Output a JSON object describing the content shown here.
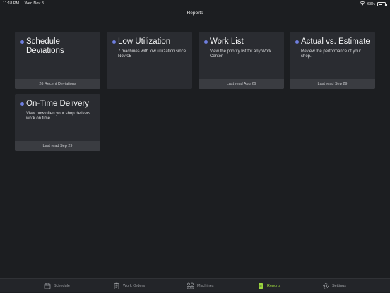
{
  "status": {
    "time": "11:18 PM",
    "date": "Wed Nov 8",
    "battery": "63%",
    "battery_level": 0.63
  },
  "nav": {
    "title": "Reports"
  },
  "cards": [
    {
      "title": "Schedule Deviations",
      "description": "",
      "footer": "26 Recent Deviations"
    },
    {
      "title": "Low Utilization",
      "description": "7 machines with low utilization since Nov 05",
      "footer": ""
    },
    {
      "title": "Work List",
      "description": "View the priority list for any Work Center",
      "footer": "Last read Aug 26"
    },
    {
      "title": "Actual vs. Estimate",
      "description": "Review the performance of your shop.",
      "footer": "Last read Sep 29"
    },
    {
      "title": "On-Time Delivery",
      "description": "View how often your shop delivers work on time",
      "footer": "Last read Sep 29"
    }
  ],
  "tabs": [
    {
      "label": "Schedule",
      "icon": "calendar-icon",
      "active": false
    },
    {
      "label": "Work Orders",
      "icon": "clipboard-icon",
      "active": false
    },
    {
      "label": "Machines",
      "icon": "machines-icon",
      "active": false
    },
    {
      "label": "Reports",
      "icon": "report-icon",
      "active": true
    },
    {
      "label": "Settings",
      "icon": "gear-icon",
      "active": false
    }
  ],
  "colors": {
    "background": "#1c1e21",
    "card": "#2a2c31",
    "card_footer": "#3a3c41",
    "dot": "#6f7fe0",
    "active_tab": "#9bd63f"
  }
}
